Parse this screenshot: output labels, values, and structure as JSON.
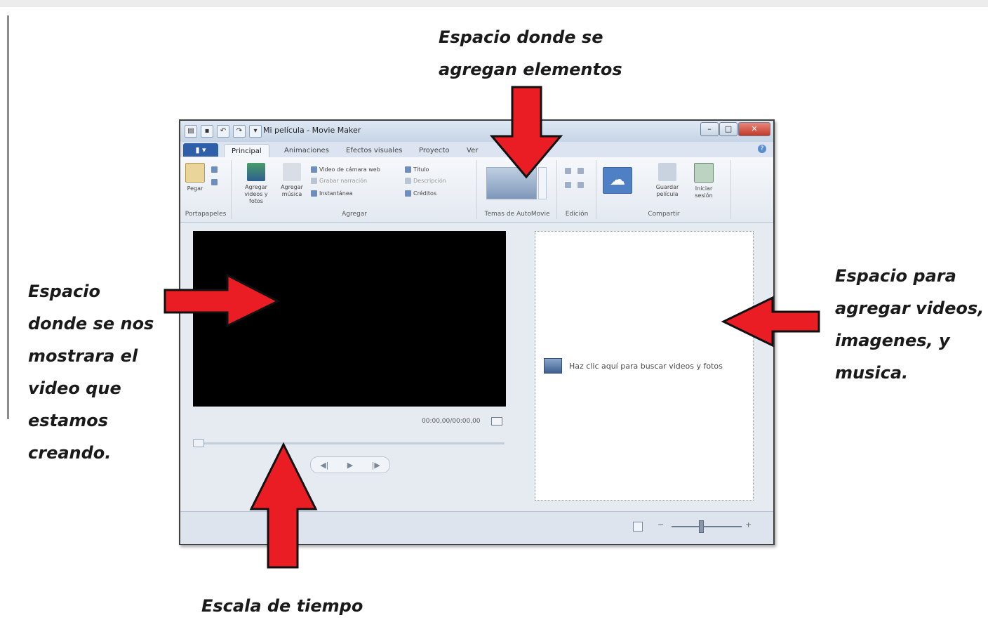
{
  "annotations": {
    "top_line1": "Espacio donde se",
    "top_line2": "agregan elementos",
    "left_lines": [
      "Espacio",
      "donde se nos",
      "mostrara el",
      "video que",
      "estamos",
      "creando."
    ],
    "right_lines": [
      "Espacio para",
      "agregar videos,",
      "imagenes, y",
      "musica."
    ],
    "bottom": "Escala de tiempo"
  },
  "window": {
    "title": "Mi película - Movie Maker",
    "file_tab": "▮ ▾",
    "tabs": [
      "Principal",
      "Animaciones",
      "Efectos visuales",
      "Proyecto",
      "Ver"
    ],
    "active_tab_index": 0
  },
  "ribbon": {
    "clipboard": {
      "paste": "Pegar",
      "group": "Portapapeles"
    },
    "add": {
      "add_videos": "Agregar videos y fotos",
      "add_music": "Agregar música",
      "webcam": "Video de cámara web",
      "narration": "Grabar narración",
      "snapshot": "Instantánea",
      "title": "Título",
      "caption": "Descripción",
      "credits": "Créditos",
      "group": "Agregar"
    },
    "automovie": {
      "group": "Temas de AutoMovie"
    },
    "editing": {
      "group": "Edición"
    },
    "share": {
      "save_movie": "Guardar película",
      "sign_in": "Iniciar sesión",
      "group": "Compartir"
    }
  },
  "player": {
    "timecode": "00:00,00/00:00,00",
    "prev_frame": "◀|",
    "play": "▶",
    "next_frame": "|▶"
  },
  "storyboard": {
    "hint": "Haz clic aquí para buscar videos y fotos"
  },
  "statusbar": {
    "zoom_minus": "−",
    "zoom_plus": "+",
    "zoom_level": 0.42
  },
  "colors": {
    "arrow_fill": "#ea1c24",
    "file_tab": "#2f5fa8",
    "preview_bg": "#000000"
  }
}
